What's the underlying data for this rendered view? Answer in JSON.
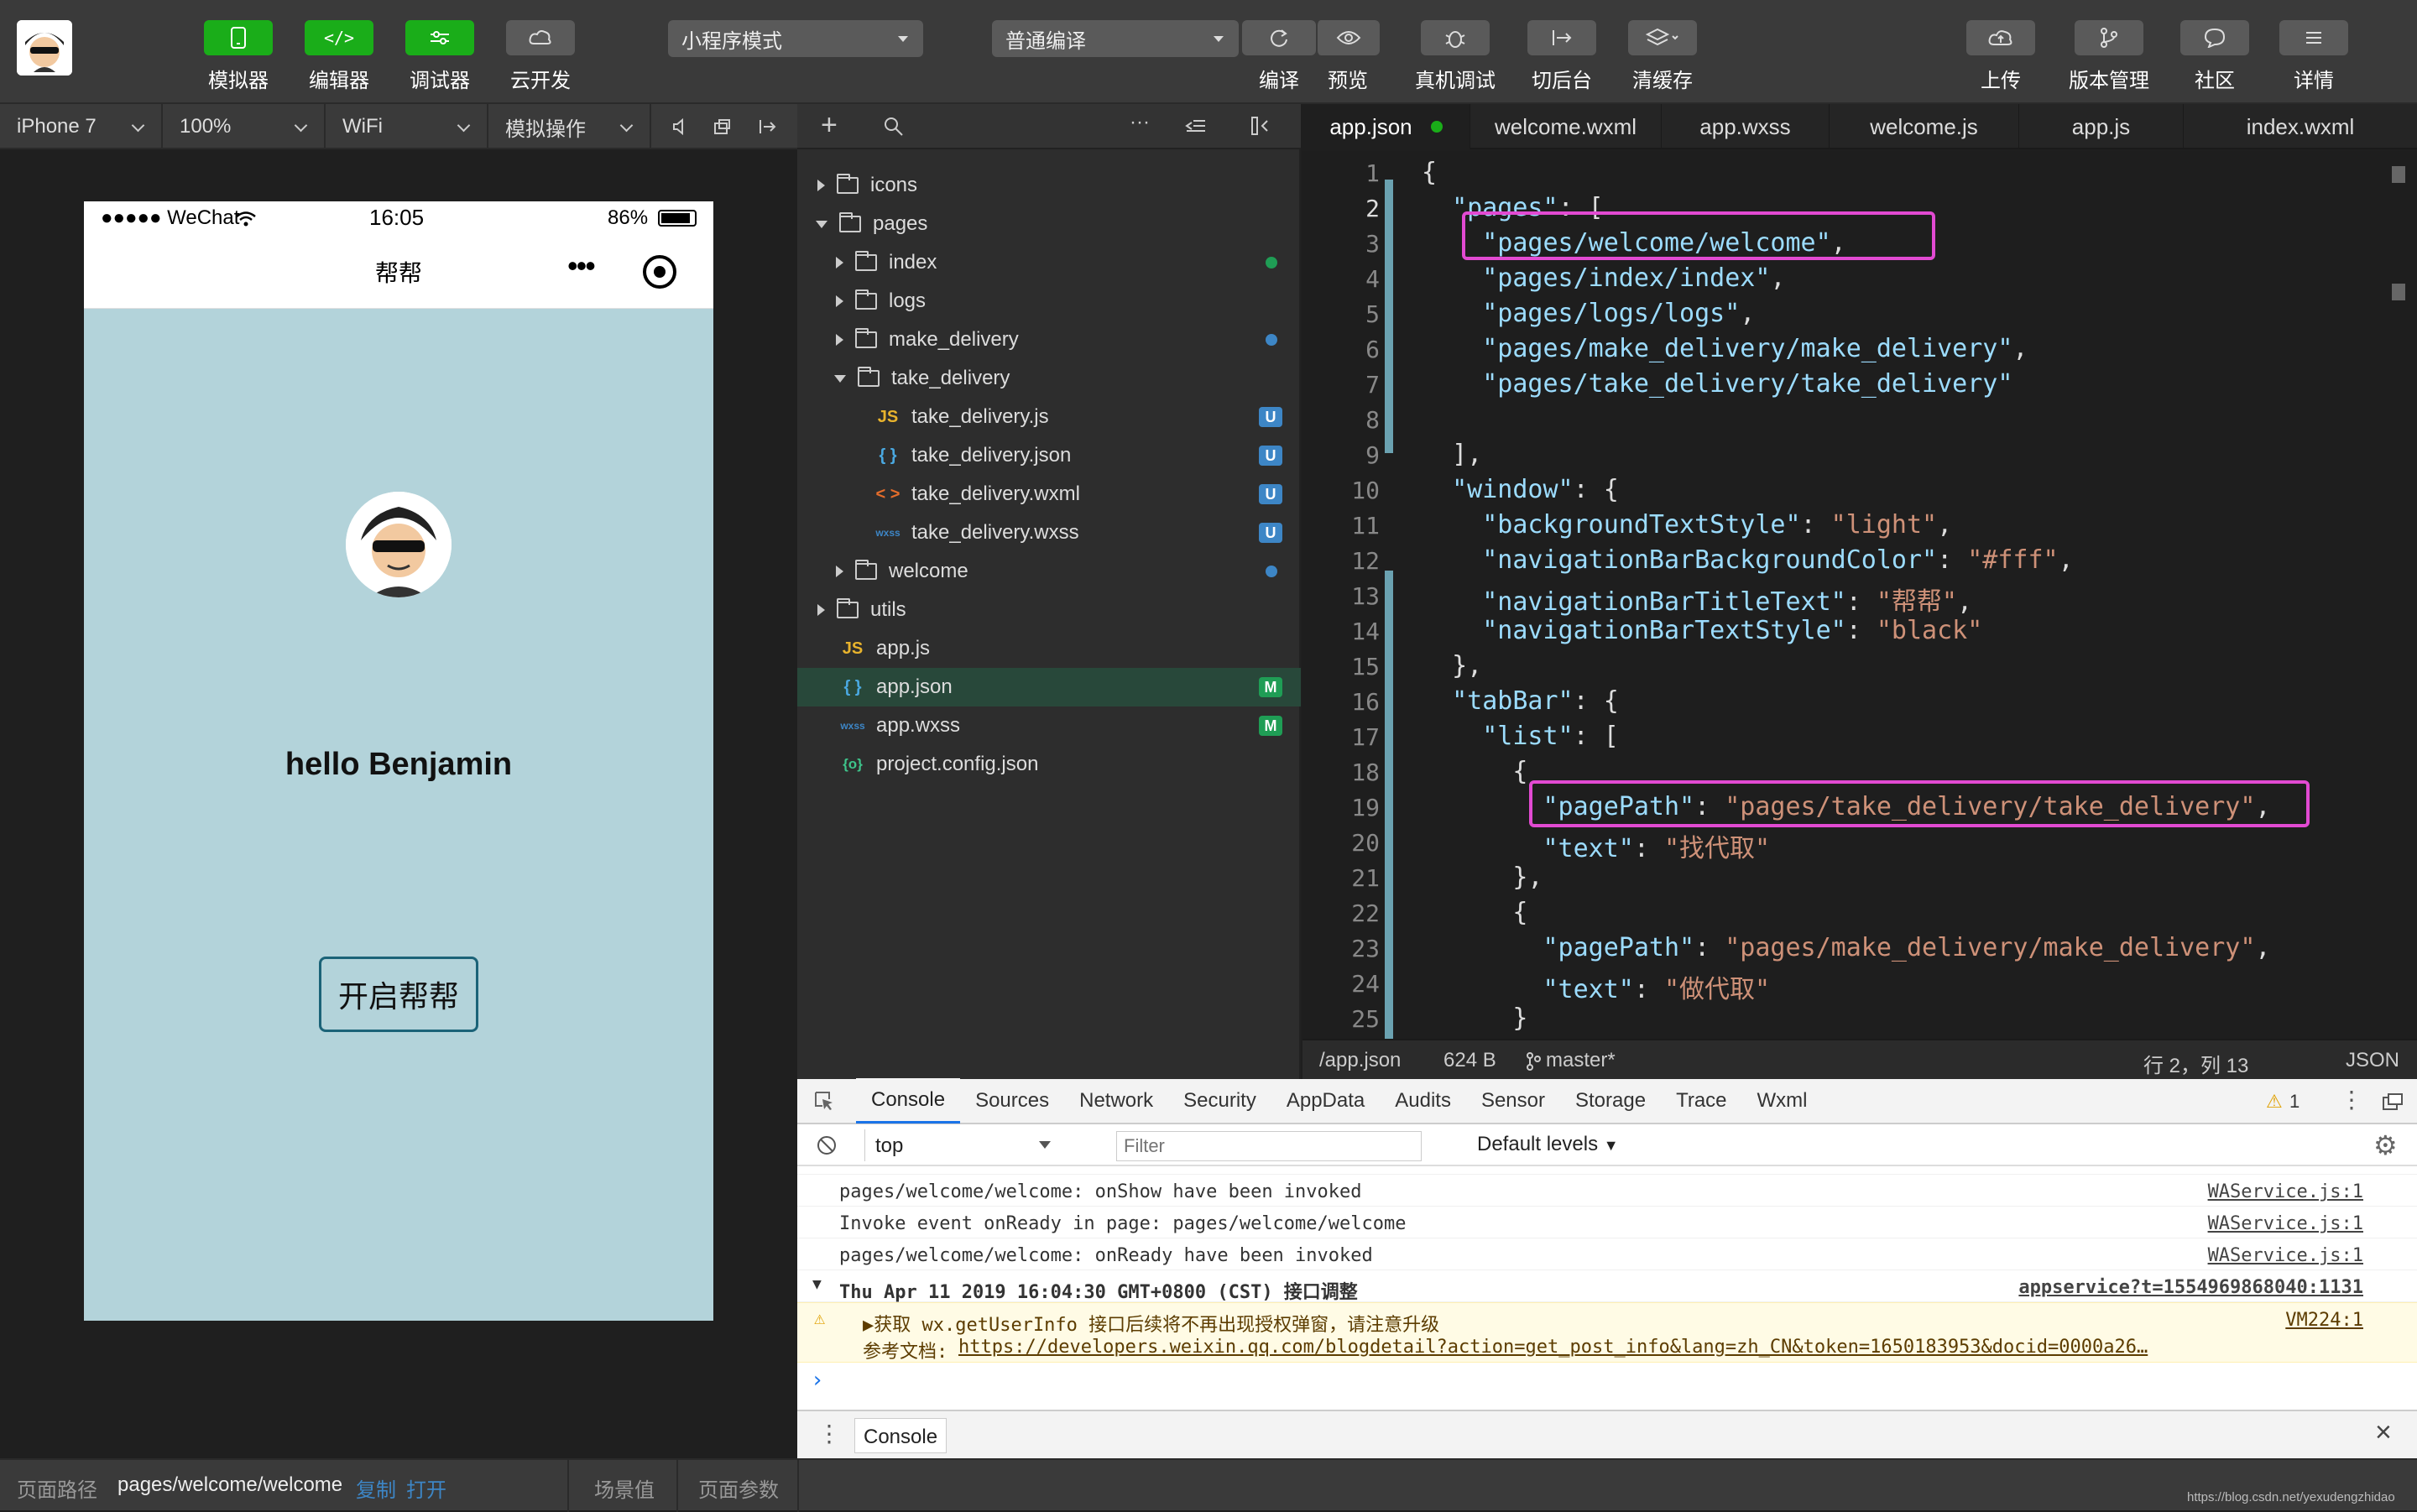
{
  "toolbar": {
    "left_buttons": [
      {
        "label": "模拟器",
        "icon": "phone-icon"
      },
      {
        "label": "编辑器",
        "icon": "code-icon"
      },
      {
        "label": "调试器",
        "icon": "sliders-icon"
      },
      {
        "label": "云开发",
        "icon": "cloud-link-icon"
      }
    ],
    "mode_select": "小程序模式",
    "compile_select": "普通编译",
    "mid_buttons": [
      {
        "label": "编译",
        "icon": "refresh-icon"
      },
      {
        "label": "预览",
        "icon": "eye-icon"
      },
      {
        "label": "真机调试",
        "icon": "bug-icon"
      },
      {
        "label": "切后台",
        "icon": "switch-icon"
      },
      {
        "label": "清缓存",
        "icon": "layers-icon"
      }
    ],
    "right_buttons": [
      {
        "label": "上传",
        "icon": "cloud-upload-icon"
      },
      {
        "label": "版本管理",
        "icon": "branch-icon"
      },
      {
        "label": "社区",
        "icon": "chat-icon"
      },
      {
        "label": "详情",
        "icon": "menu-icon"
      }
    ]
  },
  "simbar": {
    "device": "iPhone 7",
    "zoom": "100%",
    "network": "WiFi",
    "operation": "模拟操作"
  },
  "phone": {
    "carrier": "●●●●● WeChat",
    "time": "16:05",
    "battery": "86%",
    "nav_title": "帮帮",
    "greeting": "hello Benjamin",
    "button": "开启帮帮",
    "bg_color": "#b3d3da"
  },
  "explorer": {
    "items": [
      {
        "label": "icons"
      },
      {
        "label": "pages"
      },
      {
        "label": "index"
      },
      {
        "label": "logs"
      },
      {
        "label": "make_delivery"
      },
      {
        "label": "take_delivery"
      },
      {
        "label": "take_delivery.js",
        "badge": "U",
        "icon": "JS"
      },
      {
        "label": "take_delivery.json",
        "badge": "U",
        "icon": "{ }"
      },
      {
        "label": "take_delivery.wxml",
        "badge": "U",
        "icon": "< >"
      },
      {
        "label": "take_delivery.wxss",
        "badge": "U",
        "icon": "wxss"
      },
      {
        "label": "welcome"
      },
      {
        "label": "utils"
      },
      {
        "label": "app.js",
        "icon": "JS"
      },
      {
        "label": "app.json",
        "badge": "M",
        "icon": "{ }"
      },
      {
        "label": "app.wxss",
        "badge": "M",
        "icon": "wxss"
      },
      {
        "label": "project.config.json",
        "icon": "{o}"
      }
    ]
  },
  "editor": {
    "tabs": [
      "app.json",
      "welcome.wxml",
      "app.wxss",
      "welcome.js",
      "app.js",
      "index.wxml"
    ],
    "lines": [
      "{",
      "  \"pages\": [",
      "    \"pages/welcome/welcome\",",
      "    \"pages/index/index\",",
      "    \"pages/logs/logs\",",
      "    \"pages/make_delivery/make_delivery\",",
      "    \"pages/take_delivery/take_delivery\"",
      "",
      "  ],",
      "  \"window\": {",
      "    \"backgroundTextStyle\": \"light\",",
      "    \"navigationBarBackgroundColor\": \"#fff\",",
      "    \"navigationBarTitleText\": \"帮帮\",",
      "    \"navigationBarTextStyle\": \"black\"",
      "  },",
      "  \"tabBar\": {",
      "    \"list\": [",
      "      {",
      "        \"pagePath\": \"pages/take_delivery/take_delivery\",",
      "        \"text\": \"找代取\"",
      "      },",
      "      {",
      "        \"pagePath\": \"pages/make_delivery/make_delivery\",",
      "        \"text\": \"做代取\"",
      "      }"
    ],
    "line_numbers": [
      "1",
      "2",
      "3",
      "4",
      "5",
      "6",
      "7",
      "8",
      "9",
      "10",
      "11",
      "12",
      "13",
      "14",
      "15",
      "16",
      "17",
      "18",
      "19",
      "20",
      "21",
      "22",
      "23",
      "24",
      "25"
    ],
    "status": {
      "path": "/app.json",
      "size": "624 B",
      "branch": "master*",
      "position": "行 2，列 13",
      "lang": "JSON"
    }
  },
  "devtools": {
    "tabs": [
      "Console",
      "Sources",
      "Network",
      "Security",
      "AppData",
      "Audits",
      "Sensor",
      "Storage",
      "Trace",
      "Wxml"
    ],
    "warn_count": "1",
    "context": "top",
    "filter_placeholder": "Filter",
    "levels": "Default levels",
    "logs": [
      {
        "text": "pages/welcome/welcome: onShow have been invoked",
        "src": "WAService.js:1"
      },
      {
        "text": "Invoke event onReady in page: pages/welcome/welcome",
        "src": "WAService.js:1"
      },
      {
        "text": "pages/welcome/welcome: onReady have been invoked",
        "src": "WAService.js:1"
      }
    ],
    "group": {
      "text": "Thu Apr 11 2019 16:04:30 GMT+0800 (CST) 接口调整",
      "src": "appservice?t=1554969868040:1131"
    },
    "warning": {
      "text": "▶获取 wx.getUserInfo 接口后续将不再出现授权弹窗，请注意升级",
      "doc_label": "参考文档:",
      "doc_link": "https://developers.weixin.qq.com/blogdetail?action=get_post_info&lang=zh_CN&token=1650183953&docid=0000a26…",
      "src": "VM224:1"
    },
    "drawer_tab": "Console"
  },
  "bottombar": {
    "path_label": "页面路径",
    "path": "pages/welcome/welcome",
    "copy": "复制",
    "open": "打开",
    "scene": "场景值",
    "params": "页面参数",
    "watermark": "https://blog.csdn.net/yexudengzhidao"
  },
  "colors": {
    "accent_green": "#1aad19",
    "highlight_box": "#e24ad2",
    "badge_u": "#3d86c6",
    "badge_m": "#1f9d55"
  }
}
